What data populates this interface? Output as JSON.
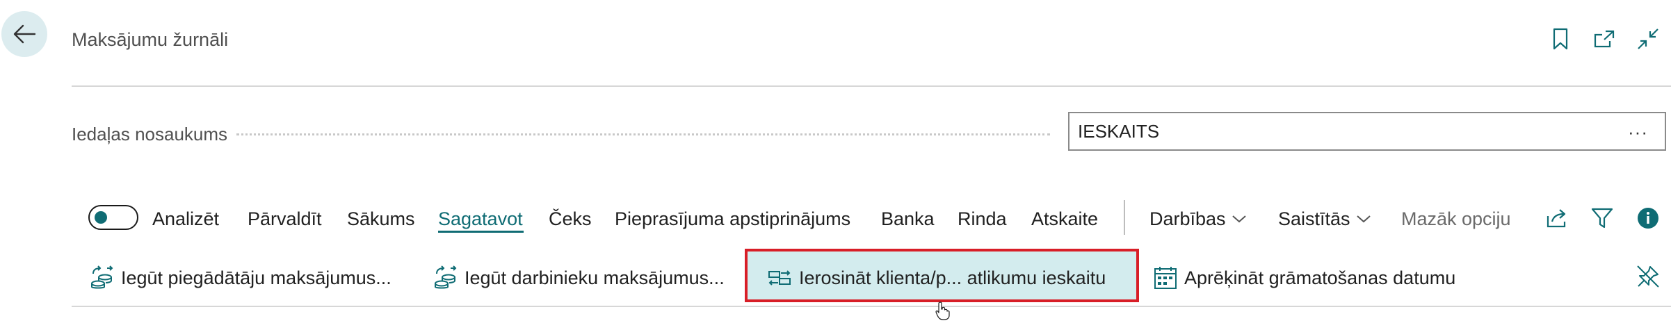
{
  "header": {
    "title": "Maksājumu žurnāli",
    "icons": [
      "bookmark-icon",
      "open-in-new-window-icon",
      "collapse-icon"
    ]
  },
  "field": {
    "label": "Iedaļas nosaukums",
    "value": "IESKAITS",
    "more": "···"
  },
  "toggle": {
    "label": "Analizēt",
    "on": true
  },
  "tabs": [
    "Pārvaldīt",
    "Sākums",
    "Sagatavot",
    "Čeks",
    "Pieprasījuma apstiprinājums",
    "Banka",
    "Rinda",
    "Atskaite"
  ],
  "active_tab": "Sagatavot",
  "menus": {
    "actions": "Darbības",
    "related": "Saistītās",
    "fewer": "Mazāk opciju"
  },
  "actions": [
    {
      "label": "Iegūt piegādātāju maksājumus...",
      "icon": "coins-arrows-icon"
    },
    {
      "label": "Iegūt darbinieku maksājumus...",
      "icon": "coins-arrows-icon"
    },
    {
      "label": "Ierosināt klienta/p... atlikumu ieskaitu",
      "icon": "money-transfer-icon",
      "highlighted": true
    },
    {
      "label": "Aprēķināt grāmatošanas datumu",
      "icon": "calendar-icon"
    }
  ],
  "colors": {
    "accent": "#0f6c74",
    "highlight_border": "#d81e27",
    "highlight_fill": "#d3ecee",
    "back_button_bg": "#dcecef"
  }
}
